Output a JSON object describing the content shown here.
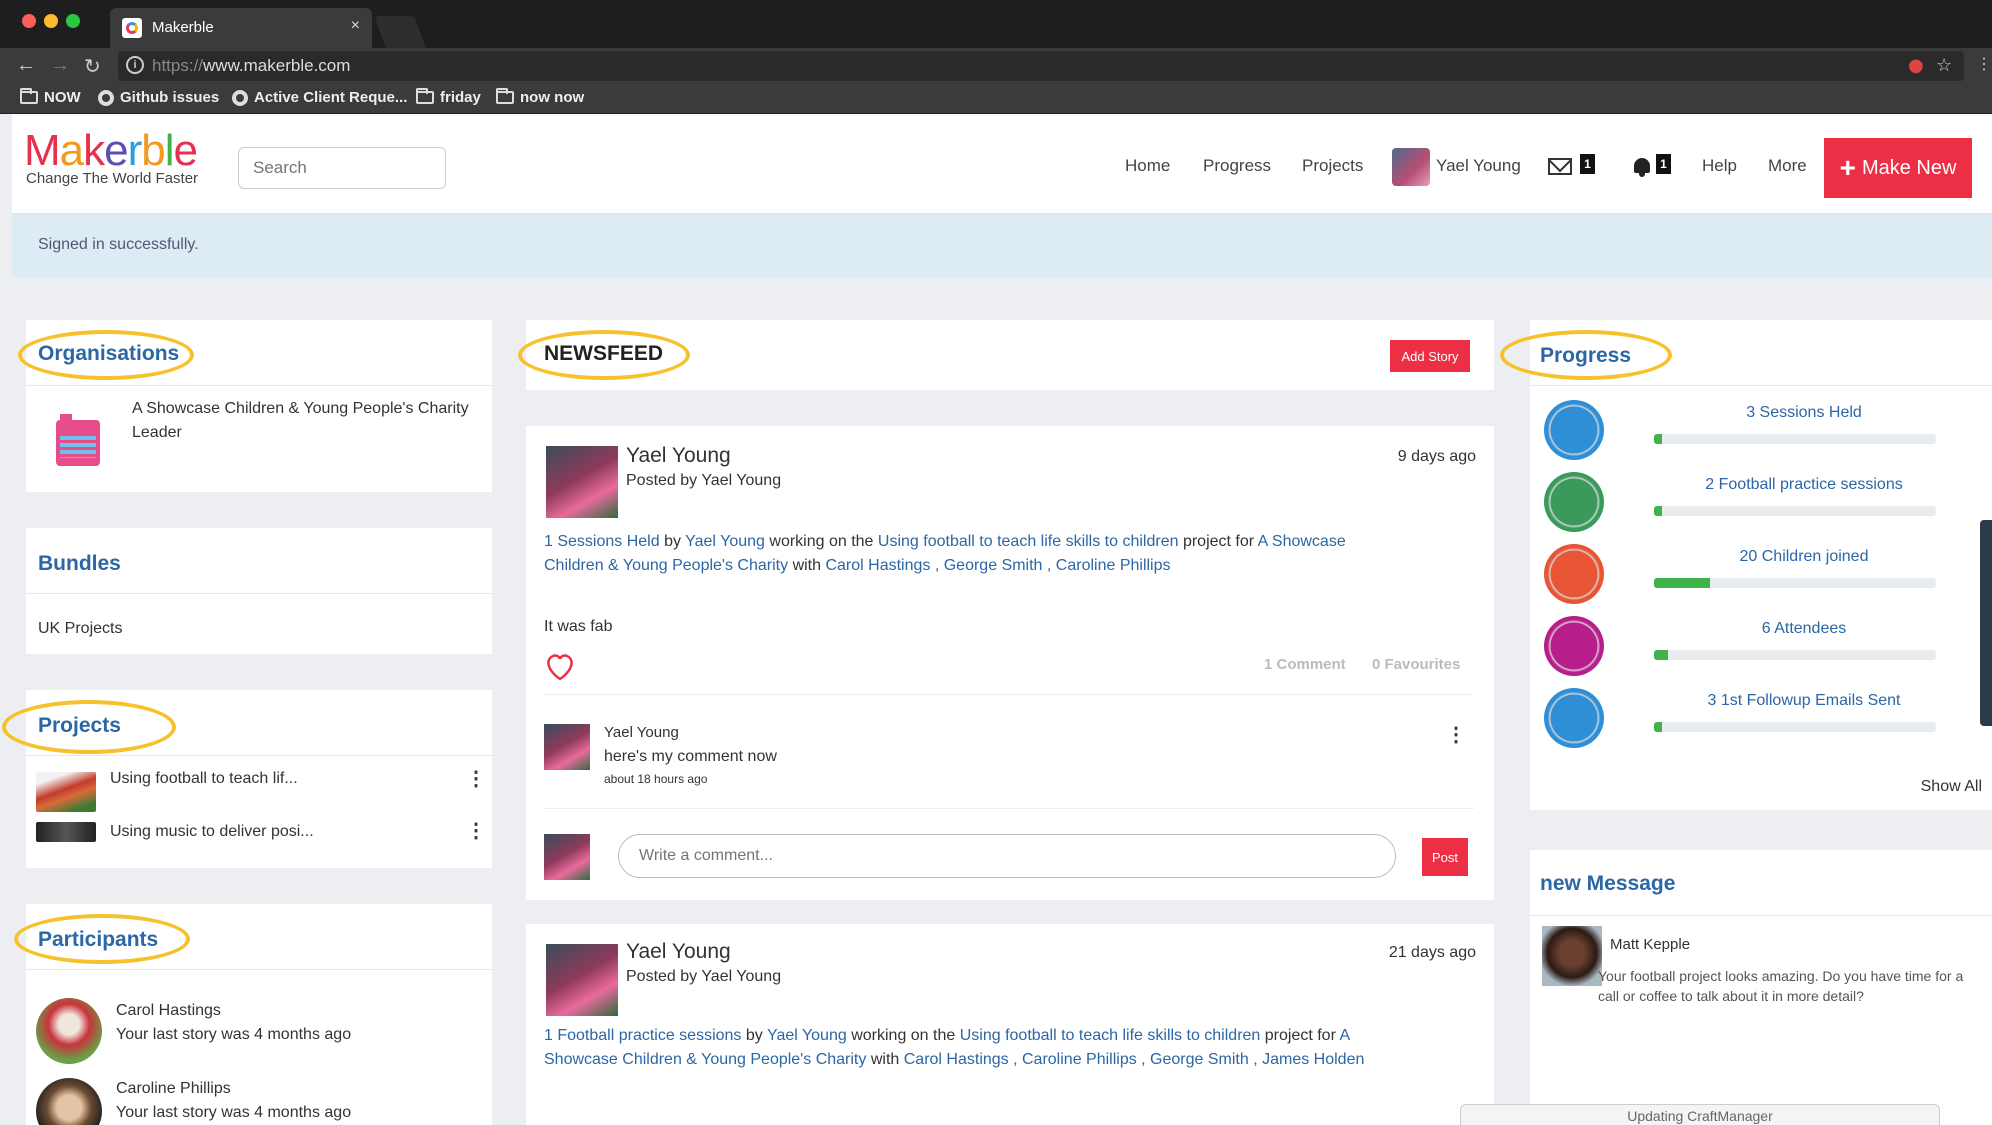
{
  "browser": {
    "tab_title": "Makerble",
    "tab_close": "×",
    "url_proto": "https://",
    "url_host": "www.makerble.com",
    "bookmarks": [
      "NOW",
      "Github issues",
      "Active Client Reque...",
      "friday",
      "now now"
    ]
  },
  "header": {
    "logo": "Makerble",
    "tagline": "Change The World Faster",
    "search_placeholder": "Search",
    "nav": [
      "Home",
      "Progress",
      "Projects"
    ],
    "user_name": "Yael Young",
    "messages_count": "1",
    "notifications_count": "1",
    "help": "Help",
    "more": "More",
    "make_new": "Make New",
    "make_new_icon": "+"
  },
  "flash": {
    "message": "Signed in successfully."
  },
  "organisations": {
    "title": "Organisations",
    "item_name": "A Showcase Children & Young People's Charity",
    "item_role": "Leader"
  },
  "bundles": {
    "title": "Bundles",
    "item": "UK Projects"
  },
  "projects": {
    "title": "Projects",
    "items": [
      "Using football to teach lif...",
      "Using music to deliver posi..."
    ]
  },
  "participants": {
    "title": "Participants",
    "items": [
      {
        "name": "Carol Hastings",
        "sub": "Your last story was 4 months ago"
      },
      {
        "name": "Caroline Phillips",
        "sub": "Your last story was 4 months ago"
      }
    ]
  },
  "newsfeed": {
    "title": "NEWSFEED",
    "add_story": "Add Story",
    "posts": [
      {
        "author": "Yael Young",
        "posted_by": "Posted by Yael Young",
        "time": "9 days ago",
        "activity": "1 Sessions Held",
        "by": "by",
        "by_name": "Yael Young",
        "working": "working on the",
        "project": "Using football to teach life skills to children",
        "project_for": "project for",
        "org1": "A Showcase",
        "org2": "Children & Young People's Charity",
        "with": "with",
        "people": "Carol Hastings , George Smith , Caroline Phillips",
        "body": "It was fab",
        "comments_count": "1 Comment",
        "favourites_count": "0 Favourites",
        "comment_author": "Yael Young",
        "comment_text": "here's my comment now",
        "comment_time": "about 18 hours ago",
        "comment_placeholder": "Write a comment...",
        "post_label": "Post"
      },
      {
        "author": "Yael Young",
        "posted_by": "Posted by Yael Young",
        "time": "21 days ago",
        "activity": "1 Football practice sessions",
        "by": "by",
        "by_name": "Yael Young",
        "working": "working on the",
        "project": "Using football to teach life skills to children",
        "project_for": "project for",
        "org1": "A",
        "org2": "Showcase Children & Young People's Charity",
        "with": "with",
        "people": "Carol Hastings , Caroline Phillips , George Smith , James Holden"
      }
    ]
  },
  "progress": {
    "title": "Progress",
    "items": [
      {
        "label": "3 Sessions Held",
        "level": 0.03,
        "color": "#2e8fd6"
      },
      {
        "label": "2 Football practice sessions",
        "level": 0.02,
        "color": "#3a9a5b"
      },
      {
        "label": "20 Children joined",
        "level": 0.2,
        "color": "#e85535"
      },
      {
        "label": "6 Attendees",
        "level": 0.05,
        "color": "#b81e8b"
      },
      {
        "label": "3 1st Followup Emails Sent",
        "level": 0.03,
        "color": "#2e8fd6"
      }
    ],
    "show_all": "Show All"
  },
  "new_message": {
    "title": "new Message",
    "sender": "Matt Kepple",
    "text": "Your football project looks amazing. Do you have time for a call or coffee to talk about it in more detail?"
  },
  "toast": "Updating CraftManager",
  "colors": {
    "accent": "#ec2f45",
    "link": "#2b66a6",
    "highlight": "#f6c12a"
  }
}
